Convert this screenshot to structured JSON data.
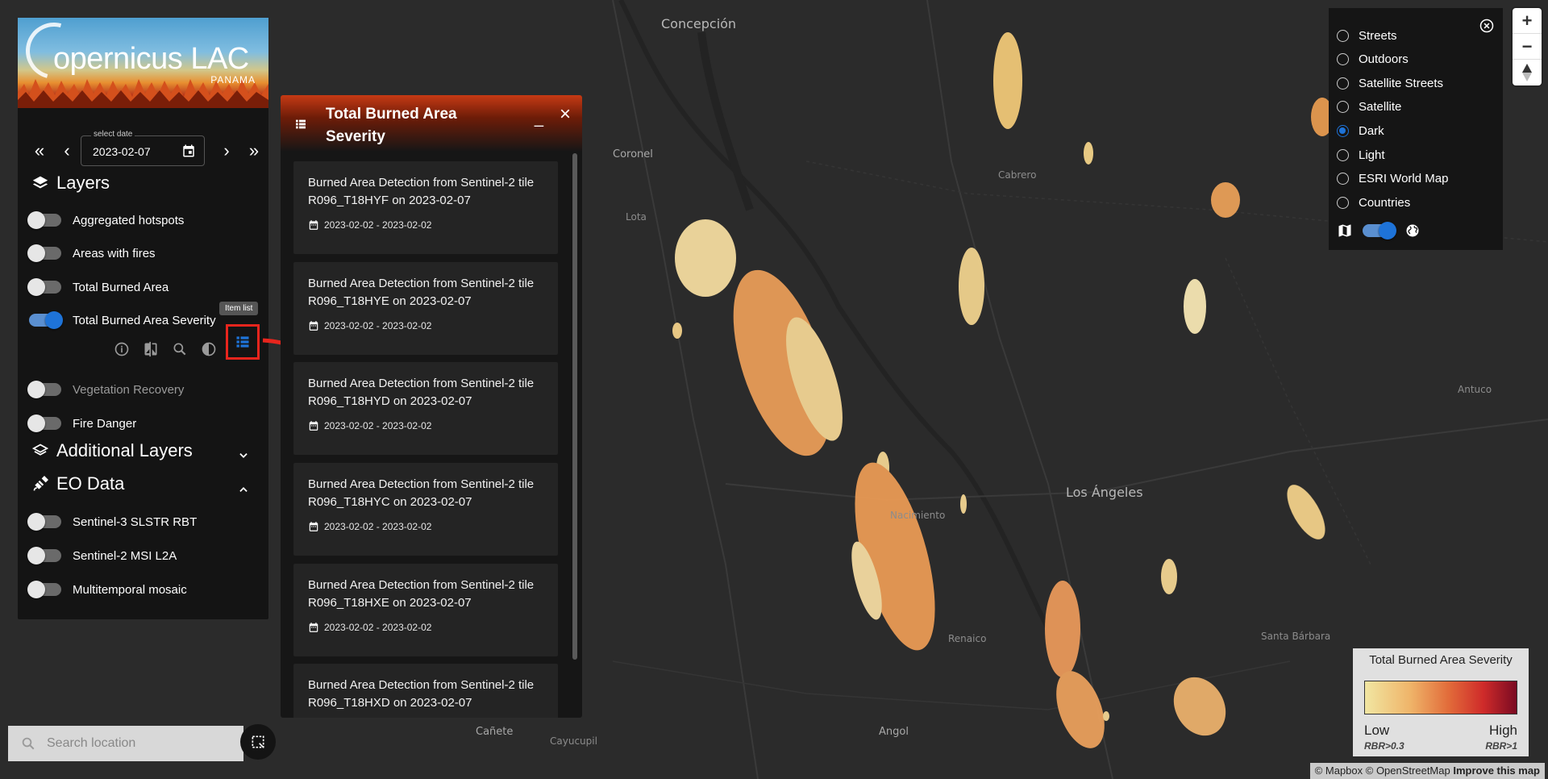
{
  "map": {
    "places": [
      "Concepción",
      "Coronel",
      "Lota",
      "Cabrero",
      "Los Ángeles",
      "Antuco",
      "Nacimiento",
      "Renaico",
      "Santa Bárbara",
      "Angol",
      "Cañete",
      "Cayucupil"
    ]
  },
  "sidebar": {
    "logo_text": "opernicus LAC",
    "logo_sub": "PANAMA",
    "date_label": "select date",
    "date_value": "2023-02-07",
    "layers_title": "Layers",
    "layers": [
      {
        "label": "Aggregated hotspots",
        "on": false
      },
      {
        "label": "Areas with fires",
        "on": false
      },
      {
        "label": "Total Burned Area",
        "on": false
      },
      {
        "label": "Total Burned Area Severity",
        "on": true
      },
      {
        "label": "Vegetation Recovery",
        "on": false
      },
      {
        "label": "Fire Danger",
        "on": false
      }
    ],
    "tooltip": "Item list",
    "additional_title": "Additional Layers",
    "eo_title": "EO Data",
    "eo_layers": [
      {
        "label": "Sentinel-3 SLSTR RBT",
        "on": false
      },
      {
        "label": "Sentinel-2 MSI L2A",
        "on": false
      },
      {
        "label": "Multitemporal mosaic",
        "on": false
      }
    ]
  },
  "panel": {
    "title": "Total Burned Area Severity",
    "items": [
      {
        "title": "Burned Area Detection from Sentinel-2 tile R096_T18HYF on 2023-02-07",
        "dates": "2023-02-02 - 2023-02-02"
      },
      {
        "title": "Burned Area Detection from Sentinel-2 tile R096_T18HYE on 2023-02-07",
        "dates": "2023-02-02 - 2023-02-02"
      },
      {
        "title": "Burned Area Detection from Sentinel-2 tile R096_T18HYD on 2023-02-07",
        "dates": "2023-02-02 - 2023-02-02"
      },
      {
        "title": "Burned Area Detection from Sentinel-2 tile R096_T18HYC on 2023-02-07",
        "dates": "2023-02-02 - 2023-02-02"
      },
      {
        "title": "Burned Area Detection from Sentinel-2 tile R096_T18HXE on 2023-02-07",
        "dates": "2023-02-02 - 2023-02-02"
      },
      {
        "title": "Burned Area Detection from Sentinel-2 tile R096_T18HXD on 2023-02-07",
        "dates": ""
      }
    ]
  },
  "basemap": {
    "options": [
      "Streets",
      "Outdoors",
      "Satellite Streets",
      "Satellite",
      "Dark",
      "Light",
      "ESRI World Map",
      "Countries"
    ],
    "selected": "Dark"
  },
  "legend": {
    "title": "Total Burned Area Severity",
    "low": "Low",
    "high": "High",
    "low_sub": "RBR>0.3",
    "high_sub": "RBR>1",
    "colors": [
      "#f1e6a2",
      "#efb469",
      "#e26c3a",
      "#cf2b2a",
      "#7a0a22"
    ]
  },
  "attribution": {
    "text": "© Mapbox © OpenStreetMap",
    "improve": "Improve this map"
  },
  "search": {
    "placeholder": "Search location"
  },
  "zoom": {
    "in": "+",
    "out": "−"
  }
}
